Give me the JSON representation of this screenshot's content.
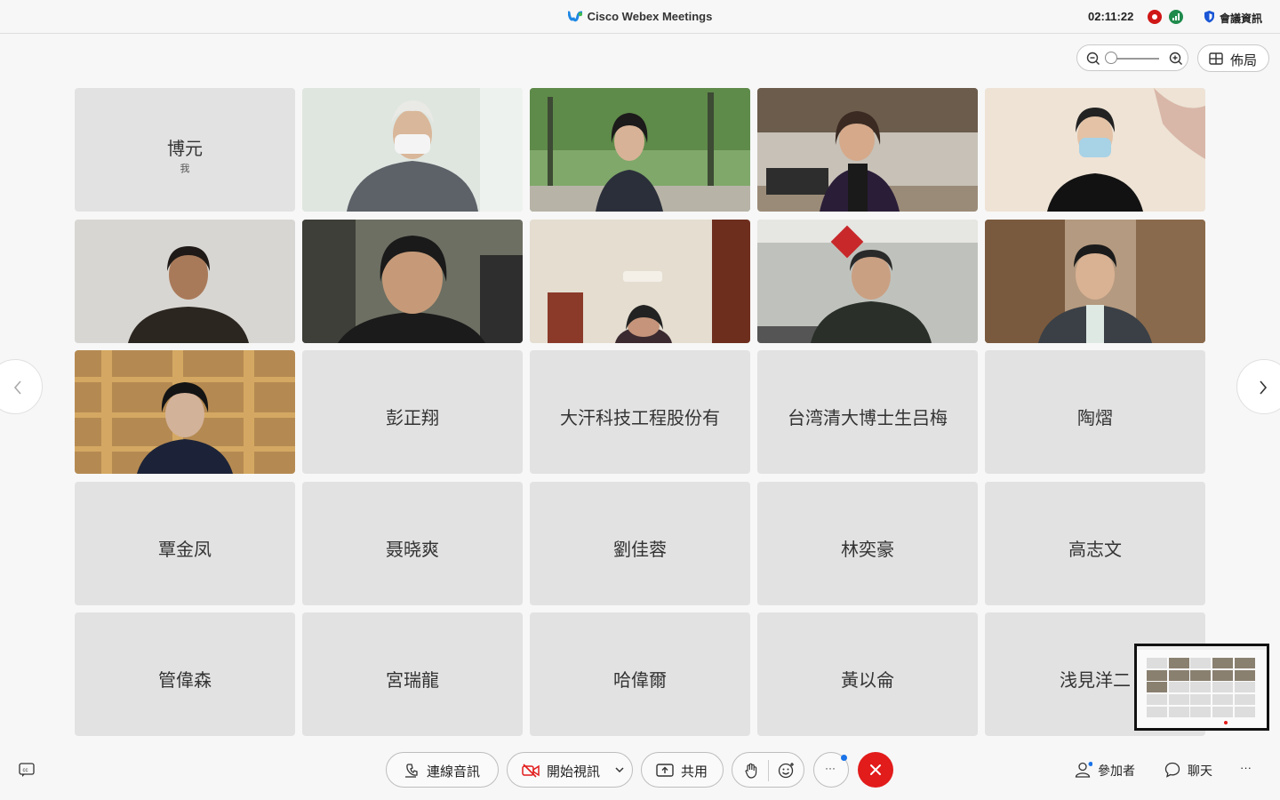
{
  "titlebar": {
    "app_title": "Cisco Webex Meetings",
    "clock": "02:11:22",
    "meeting_info": "會議資訊",
    "icons": [
      "recording-icon",
      "network-signal-icon",
      "shield-icon"
    ]
  },
  "view": {
    "layout_label": "佈局",
    "zoom_level": 0
  },
  "participants": {
    "self": {
      "name": "博元",
      "sub": "我"
    },
    "video_tiles": [
      {
        "id": "v1",
        "bg": "#dfe6e0"
      },
      {
        "id": "v2",
        "bg": "#5e8a4a"
      },
      {
        "id": "v3",
        "bg": "#9a8b78"
      },
      {
        "id": "v4",
        "bg": "#eee3d5"
      },
      {
        "id": "v5",
        "bg": "#d8d6d2"
      },
      {
        "id": "v6",
        "bg": "#6c6f62"
      },
      {
        "id": "v7",
        "bg": "#e4ddd0"
      },
      {
        "id": "v8",
        "bg": "#bfc2bc"
      },
      {
        "id": "v9",
        "bg": "#b49a80"
      },
      {
        "id": "v10",
        "bg": "#b58a52"
      }
    ],
    "names": [
      "彭正翔",
      "大汗科技工程股份有",
      "台湾清大博士生吕梅",
      "陶熠",
      "覃金凤",
      "聂晓爽",
      "劉佳蓉",
      "林奕豪",
      "高志文",
      "管偉森",
      "宮瑞龍",
      "哈偉爾",
      "黃以侖",
      "浅見洋二"
    ]
  },
  "controls": {
    "audio_label": "連線音訊",
    "video_label": "開始視訊",
    "share_label": "共用",
    "participants_label": "參加者",
    "chat_label": "聊天",
    "more_label": "···",
    "overflow_label": "···"
  },
  "colors": {
    "leave": "#e21b1b",
    "recording": "#d01717",
    "signal": "#1f8a4c",
    "accent": "#1a73e8"
  }
}
